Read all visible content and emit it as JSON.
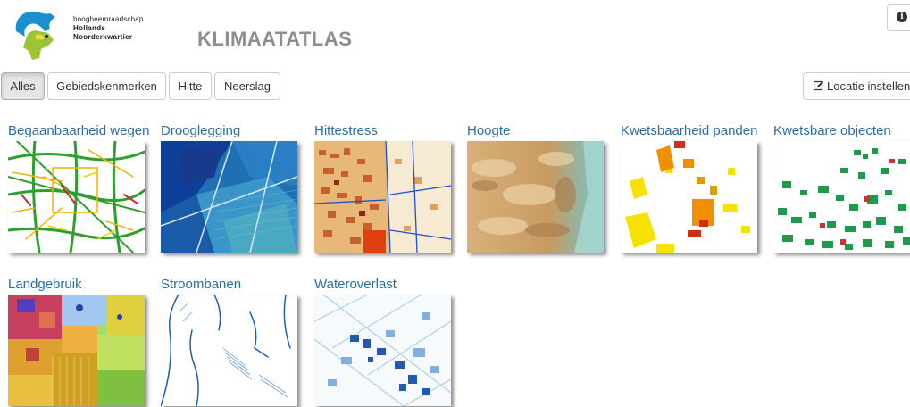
{
  "org": {
    "line1": "hoogheemraadschap",
    "line2": "Hollands",
    "line3": "Noorderkwartier"
  },
  "app_title": "KLIMAATATLAS",
  "filters": [
    {
      "label": "Alles",
      "active": true
    },
    {
      "label": "Gebiedskenmerken",
      "active": false
    },
    {
      "label": "Hitte",
      "active": false
    },
    {
      "label": "Neerslag",
      "active": false
    }
  ],
  "location_button": {
    "label": "Locatie instellen",
    "icon": "edit-icon"
  },
  "info_button": {
    "icon": "info-circle-icon"
  },
  "maps": [
    {
      "title": "Begaanbaarheid wegen",
      "thumb": "roads"
    },
    {
      "title": "Drooglegging",
      "thumb": "drainage"
    },
    {
      "title": "Hittestress",
      "thumb": "heat"
    },
    {
      "title": "Hoogte",
      "thumb": "elevation"
    },
    {
      "title": "Kwetsbaarheid panden",
      "thumb": "buildings"
    },
    {
      "title": "Kwetsbare objecten",
      "thumb": "objects"
    },
    {
      "title": "Landgebruik",
      "thumb": "landuse"
    },
    {
      "title": "Stroombanen",
      "thumb": "flowpaths"
    },
    {
      "title": "Wateroverlast",
      "thumb": "flooding"
    }
  ],
  "colors": {
    "link": "#2a6da6",
    "title_gray": "#8e8e8e",
    "logo_blue": "#1b8fd0",
    "logo_green": "#9cc434"
  }
}
